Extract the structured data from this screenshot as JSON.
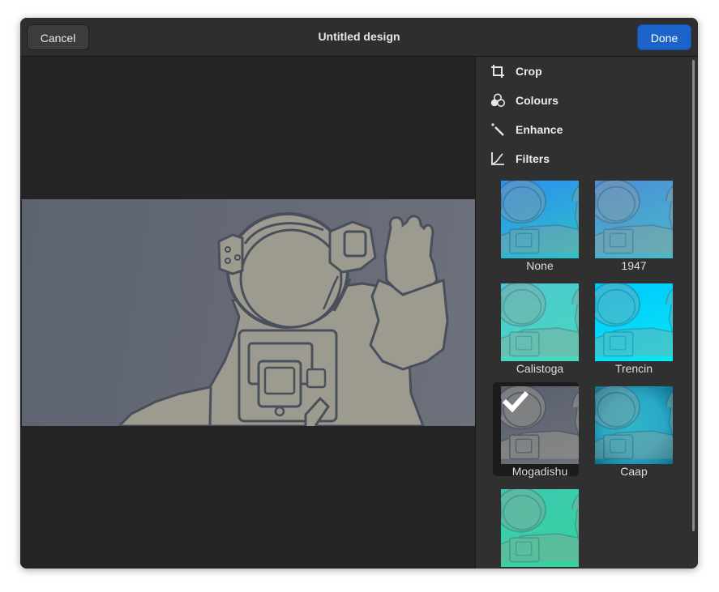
{
  "header": {
    "cancel_label": "Cancel",
    "title": "Untitled design",
    "done_label": "Done",
    "accent_color": "#1c63c9"
  },
  "tools": [
    {
      "label": "Crop",
      "icon": "crop-icon"
    },
    {
      "label": "Colours",
      "icon": "colours-icon"
    },
    {
      "label": "Enhance",
      "icon": "magic-wand-icon"
    },
    {
      "label": "Filters",
      "icon": "filter-curve-icon"
    }
  ],
  "filters": [
    {
      "label": "None",
      "selected": false
    },
    {
      "label": "1947",
      "selected": false
    },
    {
      "label": "Calistoga",
      "selected": false
    },
    {
      "label": "Trencin",
      "selected": false
    },
    {
      "label": "Mogadishu",
      "selected": true
    },
    {
      "label": "Caap",
      "selected": false
    },
    {
      "label": "",
      "selected": false
    }
  ]
}
